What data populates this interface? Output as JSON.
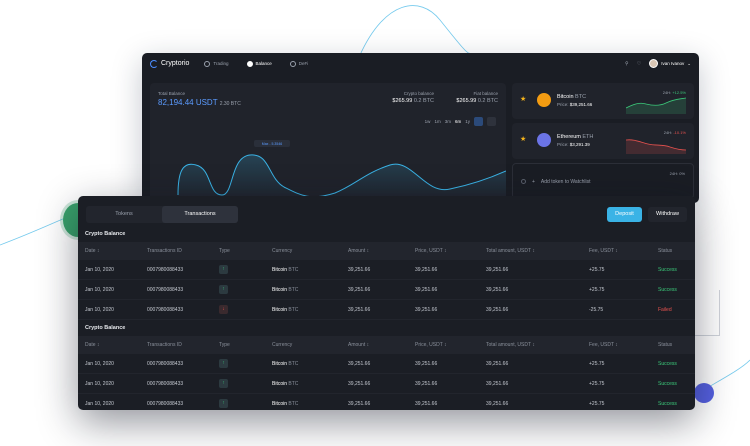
{
  "app": {
    "name": "Cryptorio"
  },
  "nav": [
    {
      "label": "Trading",
      "active": false
    },
    {
      "label": "Balance",
      "active": true
    },
    {
      "label": "DeFi",
      "active": false
    }
  ],
  "user": {
    "name": "Ivan Ivanov"
  },
  "balance": {
    "total_label": "Total Balance",
    "total_value": "82,194.44 USDT",
    "total_btc": "2.30 BTC",
    "crypto_label": "Crypto balance",
    "crypto_value": "$265.99",
    "crypto_btc": "0.2 BTC",
    "fiat_label": "Fiat balance",
    "fiat_value": "$265.99",
    "fiat_btc": "0.2 BTC",
    "max_label": "Max - 5.3546",
    "ranges": [
      "1w",
      "1m",
      "3m",
      "6m",
      "1y"
    ],
    "selected_range": "6m"
  },
  "watchlist": [
    {
      "name": "Bitcoin",
      "code": "BTC",
      "price_label": "Price:",
      "price": "$39,251.66",
      "period": "24H:",
      "change": "+12.5%",
      "direction": "up",
      "color": "#3bc97a"
    },
    {
      "name": "Ethereum",
      "code": "ETH",
      "price_label": "Price:",
      "price": "$3,291.39",
      "period": "24H:",
      "change": "-10.1%",
      "direction": "down",
      "color": "#e8524f"
    }
  ],
  "add_watch": {
    "label": "Add token to Watchlist",
    "period": "24H:",
    "change": "0%"
  },
  "tabs": [
    {
      "label": "Tokens",
      "active": false
    },
    {
      "label": "Transactions",
      "active": true
    }
  ],
  "actions": {
    "deposit": "Deposit",
    "withdraw": "Withdraw"
  },
  "sections": [
    {
      "title": "Crypto Balance",
      "headers": {
        "date": "Date",
        "id": "Transactions ID",
        "type": "Type",
        "currency": "Currency",
        "amount": "Amount",
        "price": "Price, USDT",
        "total": "Total amount, USDT",
        "fee": "Fee, USDT",
        "status": "Status"
      },
      "rows": [
        {
          "date": "Jan 10, 2020",
          "id": "0007980088433",
          "type": "in",
          "currency": "Bitcoin",
          "code": "BTC",
          "amount": "39,251.66",
          "price": "39,251.66",
          "total": "39,251.66",
          "fee": "+25.75",
          "status": "Success"
        },
        {
          "date": "Jan 10, 2020",
          "id": "0007980088433",
          "type": "in",
          "currency": "Bitcoin",
          "code": "BTC",
          "amount": "39,251.66",
          "price": "39,251.66",
          "total": "39,251.66",
          "fee": "+25.75",
          "status": "Success"
        },
        {
          "date": "Jan 10, 2020",
          "id": "0007980088433",
          "type": "out",
          "currency": "Bitcoin",
          "code": "BTC",
          "amount": "39,251.66",
          "price": "39,251.66",
          "total": "39,251.66",
          "fee": "-25.75",
          "status": "Failed"
        }
      ]
    },
    {
      "title": "Crypto Balance",
      "headers": {
        "date": "Date",
        "id": "Transactions ID",
        "type": "Type",
        "currency": "Currency",
        "amount": "Amount",
        "price": "Price, USDT",
        "total": "Total amount, USDT",
        "fee": "Fee, USDT",
        "status": "Status"
      },
      "rows": [
        {
          "date": "Jan 10, 2020",
          "id": "0007980088433",
          "type": "in",
          "currency": "Bitcoin",
          "code": "BTC",
          "amount": "39,251.66",
          "price": "39,251.66",
          "total": "39,251.66",
          "fee": "+25.75",
          "status": "Success"
        },
        {
          "date": "Jan 10, 2020",
          "id": "0007980088433",
          "type": "in",
          "currency": "Bitcoin",
          "code": "BTC",
          "amount": "39,251.66",
          "price": "39,251.66",
          "total": "39,251.66",
          "fee": "+25.75",
          "status": "Success"
        },
        {
          "date": "Jan 10, 2020",
          "id": "0007980088433",
          "type": "in",
          "currency": "Bitcoin",
          "code": "BTC",
          "amount": "39,251.66",
          "price": "39,251.66",
          "total": "39,251.66",
          "fee": "+25.75",
          "status": "Success"
        }
      ]
    }
  ],
  "colors": {
    "accent": "#3ab3e6",
    "success": "#3bc97a",
    "danger": "#e8524f",
    "brand": "#5b9bff"
  }
}
